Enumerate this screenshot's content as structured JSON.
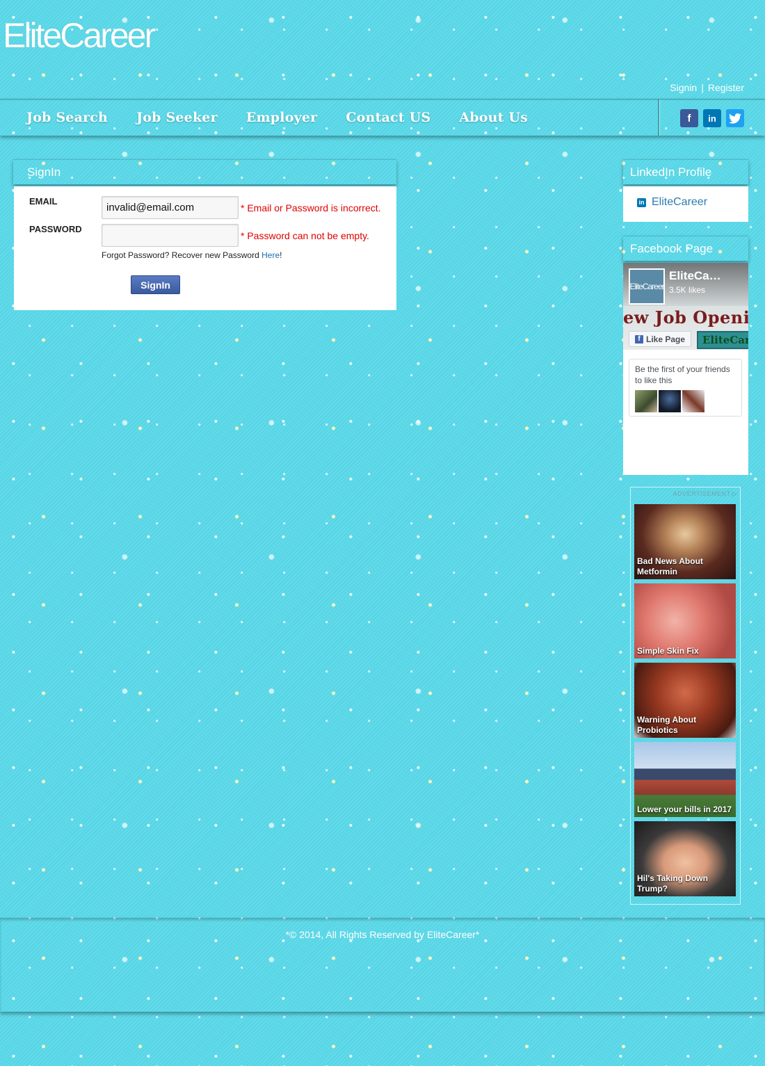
{
  "site": {
    "logo": "EliteCareer"
  },
  "header": {
    "signin": "Signin",
    "separator": "|",
    "register": "Register"
  },
  "nav": {
    "items": [
      "Job Search",
      "Job Seeker",
      "Employer",
      "Contact US",
      "About Us"
    ]
  },
  "social": {
    "facebook": "f",
    "linkedin": "in",
    "twitter": "t"
  },
  "signin": {
    "title": "SignIn",
    "email_label": "EMAIL",
    "email_value": "invalid@email.com",
    "email_error": "* Email or Password is incorrect.",
    "password_label": "PASSWORD",
    "password_value": "",
    "password_error": "* Password can not be empty.",
    "forgot_text": "Forgot Password? Recover new Password ",
    "forgot_link": "Here",
    "forgot_end": "!",
    "button": "SignIn"
  },
  "linkedin": {
    "title": "LinkedIn Profile",
    "icon": "in",
    "link": "EliteCareer"
  },
  "facebook": {
    "title": "Facebook Page",
    "page_logo": "EliteCareer",
    "page_name": "EliteCa…",
    "likes": "3.5K likes",
    "banner": "ew Job Openin",
    "like_button": "Like Page",
    "like_icon": "f",
    "brand_tag": "EliteCar",
    "friends_text": "Be the first of your friends to like this"
  },
  "ads": {
    "label": "ADVERTISEMENT",
    "items": [
      {
        "caption": "Bad News About Metformin"
      },
      {
        "caption": "Simple Skin Fix"
      },
      {
        "caption": "Warning About Probiotics"
      },
      {
        "caption": "Lower your bills in 2017"
      },
      {
        "caption": "Hil's Taking Down Trump?"
      }
    ]
  },
  "footer": {
    "copyright": "*© 2014, All Rights Reserved by EliteCareer*"
  },
  "colors": {
    "background": "#57d6e6",
    "error": "#e00000",
    "button": "#3b5a9e",
    "linkedin": "#0077b5",
    "facebook": "#3b5998",
    "twitter": "#1da1f2"
  }
}
